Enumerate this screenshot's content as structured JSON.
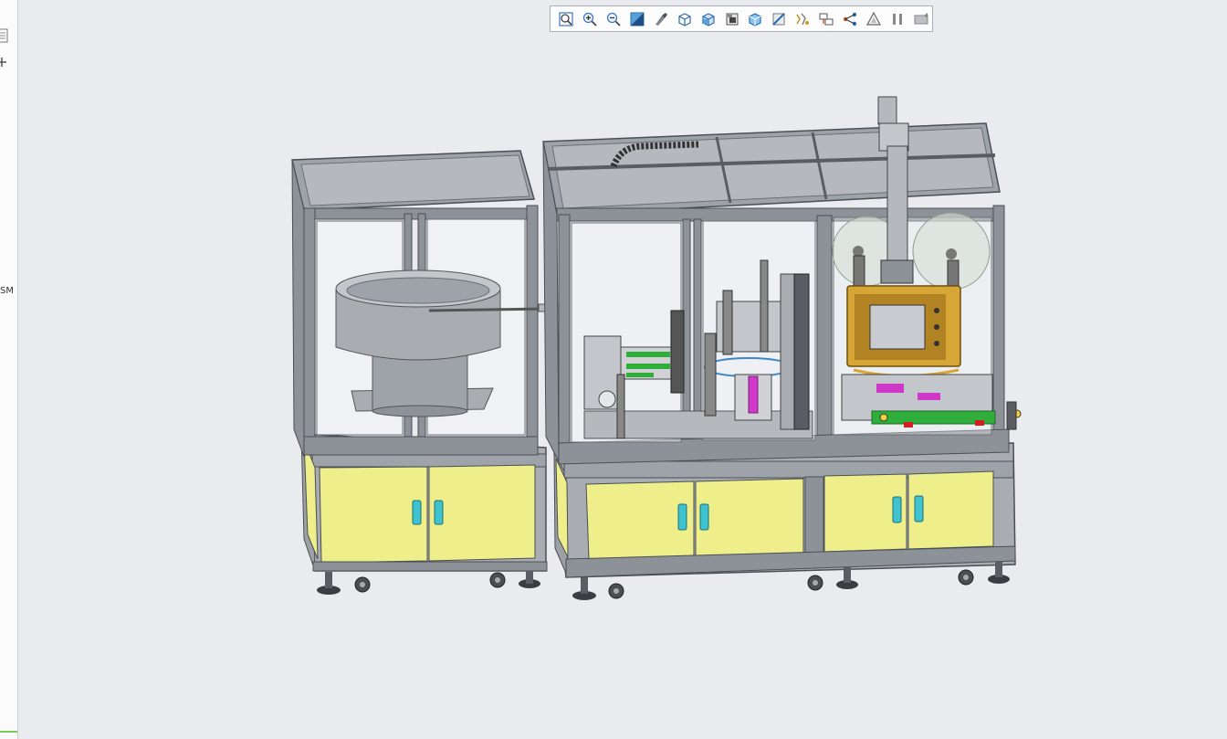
{
  "sidebar": {
    "truncated_label": "SM",
    "doc_icon": "document-icon",
    "plus_icon": "plus-icon"
  },
  "toolbar": {
    "tools": [
      {
        "name": "zoom-fit-icon"
      },
      {
        "name": "zoom-in-icon"
      },
      {
        "name": "zoom-out-icon"
      },
      {
        "name": "zoom-area-icon"
      },
      {
        "name": "previous-view-icon"
      },
      {
        "name": "section-view-icon"
      },
      {
        "name": "view-orientation-icon"
      },
      {
        "name": "display-style-icon"
      },
      {
        "name": "hide-show-icon"
      },
      {
        "name": "edit-appearance-icon"
      },
      {
        "name": "apply-scene-icon"
      },
      {
        "name": "view-settings-icon"
      },
      {
        "name": "cameras-icon"
      },
      {
        "name": "tree-structure-icon"
      },
      {
        "name": "triangle-display-icon"
      },
      {
        "name": "pause-icon"
      },
      {
        "name": "screen-capture-icon"
      }
    ]
  },
  "colors": {
    "background": "#e9ebef",
    "frame": "#8d9298",
    "panel_yellow": "#eeee8a",
    "handle_cyan": "#3ec3cf",
    "touch_panel": "#d7a636",
    "green_parts": "#2fae3c",
    "magenta_parts": "#cf38c9"
  }
}
